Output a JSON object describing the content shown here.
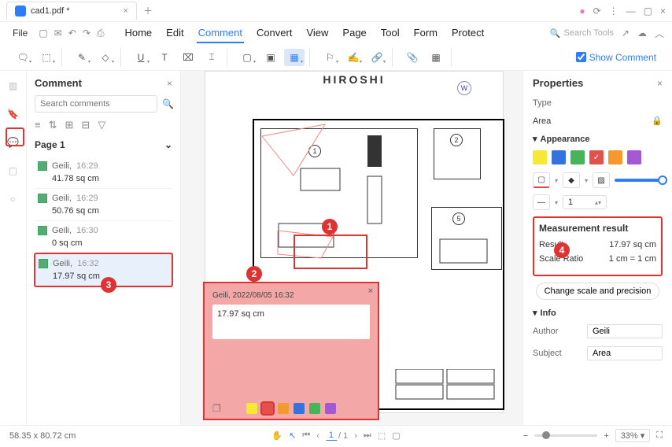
{
  "tab": {
    "title": "cad1.pdf *"
  },
  "menu": {
    "file": "File",
    "home": "Home",
    "edit": "Edit",
    "comment": "Comment",
    "convert": "Convert",
    "view": "View",
    "page": "Page",
    "tool": "Tool",
    "form": "Form",
    "protect": "Protect"
  },
  "search_tools_placeholder": "Search Tools",
  "show_comment": "Show Comment",
  "comment_panel": {
    "title": "Comment",
    "search_placeholder": "Search comments",
    "page_label": "Page 1",
    "items": [
      {
        "user": "Geili,",
        "time": "16:29",
        "value": "41.78 sq cm"
      },
      {
        "user": "Geili,",
        "time": "16:29",
        "value": "50.76 sq cm"
      },
      {
        "user": "Geili,",
        "time": "16:30",
        "value": "0 sq cm"
      },
      {
        "user": "Geili,",
        "time": "16:32",
        "value": "17.97 sq cm"
      }
    ]
  },
  "popup": {
    "meta": "Geili,  2022/08/05 16:32",
    "value": "17.97 sq cm"
  },
  "doc_title": "HIROSHI",
  "properties": {
    "title": "Properties",
    "type_label": "Type",
    "type_value": "Area",
    "appearance_label": "Appearance",
    "thickness": "1",
    "measurement": {
      "title": "Measurement result",
      "result_label": "Result",
      "result_value": "17.97 sq cm",
      "ratio_label": "Scale Ratio",
      "ratio_value": "1 cm = 1 cm",
      "change_button": "Change scale and precision"
    },
    "info_label": "Info",
    "author_label": "Author",
    "author_value": "Geili",
    "subject_label": "Subject",
    "subject_value": "Area"
  },
  "statusbar": {
    "coords": "58.35 x 80.72 cm",
    "page_current": "1",
    "page_total": "/ 1",
    "zoom": "33%"
  },
  "markers": {
    "m1": "1",
    "m2": "2",
    "m3": "3",
    "m4": "4"
  }
}
